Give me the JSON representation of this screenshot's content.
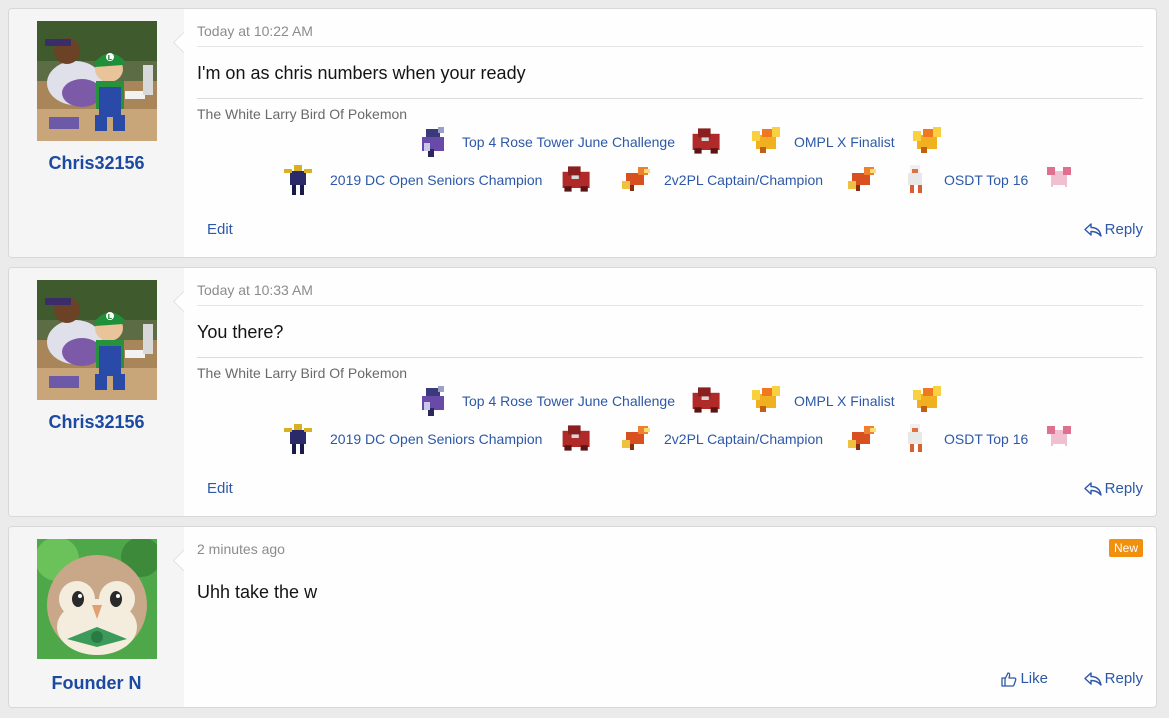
{
  "posts": [
    {
      "author": "Chris32156",
      "avatar_icon": "luigi-baseball-avatar",
      "date": "Today at 10:22 AM",
      "message": "I'm on as chris numbers when your ready",
      "signature": {
        "title": "The White Larry Bird Of Pokemon",
        "row1": [
          "Top 4 Rose Tower June Challenge",
          "OMPL X Finalist"
        ],
        "row2": [
          "2019 DC Open Seniors Champion",
          "2v2PL Captain/Champion",
          "OSDT Top 16"
        ]
      },
      "edit_label": "Edit",
      "reply_label": "Reply"
    },
    {
      "author": "Chris32156",
      "avatar_icon": "luigi-baseball-avatar",
      "date": "Today at 10:33 AM",
      "message": "You there?",
      "signature": {
        "title": "The White Larry Bird Of Pokemon",
        "row1": [
          "Top 4 Rose Tower June Challenge",
          "OMPL X Finalist"
        ],
        "row2": [
          "2019 DC Open Seniors Champion",
          "2v2PL Captain/Champion",
          "OSDT Top 16"
        ]
      },
      "edit_label": "Edit",
      "reply_label": "Reply"
    },
    {
      "author": "Founder N",
      "avatar_icon": "rowlet-avatar",
      "date": "2 minutes ago",
      "badge": "New",
      "message": "Uhh take the w",
      "like_label": "Like",
      "reply_label": "Reply"
    }
  ],
  "colors": {
    "link": "#2d58a7",
    "username": "#1c4aa0",
    "badge": "#f0900e",
    "sidebar": "#f5f5f5",
    "page": "#ebebeb"
  }
}
